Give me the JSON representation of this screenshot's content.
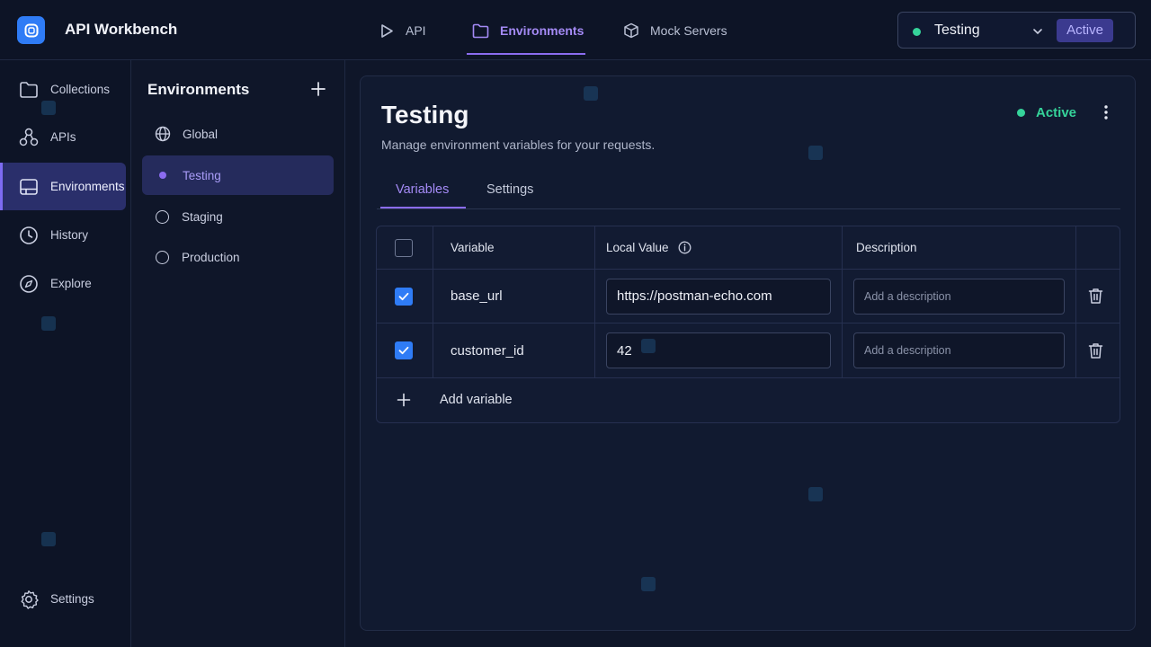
{
  "app": {
    "title": "API Workbench"
  },
  "topnav": {
    "items": [
      {
        "label": "API",
        "icon": "play-icon"
      },
      {
        "label": "Environments",
        "icon": "folder-icon"
      },
      {
        "label": "Mock Servers",
        "icon": "cube-icon"
      }
    ],
    "active_index": 1
  },
  "env_switcher": {
    "name": "Testing",
    "badge": "Active"
  },
  "rail": {
    "items": [
      {
        "label": "Collections",
        "icon": "folder-icon"
      },
      {
        "label": "APIs",
        "icon": "apis-icon"
      },
      {
        "label": "Environments",
        "icon": "monitor-icon"
      },
      {
        "label": "History",
        "icon": "clock-icon"
      },
      {
        "label": "Explore",
        "icon": "compass-icon"
      }
    ],
    "settings_label": "Settings"
  },
  "env_panel": {
    "title": "Environments",
    "items": [
      {
        "label": "Global",
        "icon": "globe-icon"
      },
      {
        "label": "Testing",
        "icon": "dot-icon"
      },
      {
        "label": "Staging",
        "icon": "circle-icon"
      },
      {
        "label": "Production",
        "icon": "circle-icon"
      }
    ],
    "active_index": 1
  },
  "main": {
    "title": "Testing",
    "subtitle": "Manage environment variables for your requests.",
    "status": "Active",
    "tabs": [
      "Variables",
      "Settings"
    ],
    "table": {
      "headers": {
        "variable": "Variable",
        "local_value": "Local Value",
        "description": "Description"
      },
      "rows": [
        {
          "checked": true,
          "variable": "base_url",
          "local_value": "https://postman-echo.com",
          "description_placeholder": "Add a description"
        },
        {
          "checked": true,
          "variable": "customer_id",
          "local_value": "42",
          "description_placeholder": "Add a description"
        }
      ],
      "add_label": "Add variable"
    }
  },
  "colors": {
    "accent": "#8b6cf0",
    "success": "#35d39a",
    "brand": "#2f7cf6",
    "background": "#0f1629"
  }
}
